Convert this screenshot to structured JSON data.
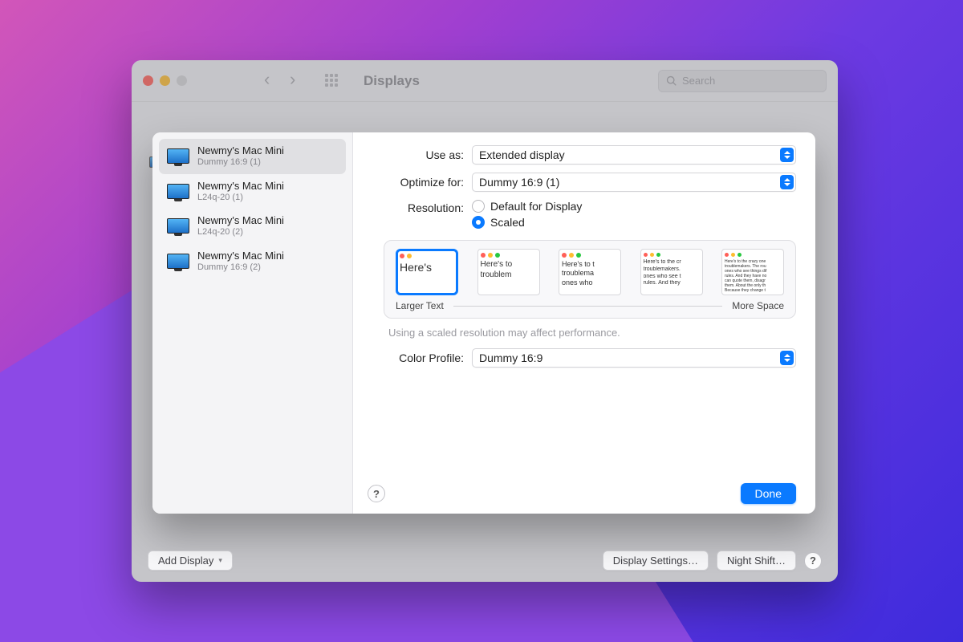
{
  "window": {
    "title": "Displays",
    "search_placeholder": "Search",
    "buttons": {
      "add_display": "Add Display",
      "display_settings": "Display Settings…",
      "night_shift": "Night Shift…"
    }
  },
  "sidebar": {
    "items": [
      {
        "title": "Newmy's Mac Mini",
        "subtitle": "Dummy 16:9 (1)",
        "selected": true
      },
      {
        "title": "Newmy's Mac Mini",
        "subtitle": "L24q-20 (1)",
        "selected": false
      },
      {
        "title": "Newmy's Mac Mini",
        "subtitle": "L24q-20 (2)",
        "selected": false
      },
      {
        "title": "Newmy's Mac Mini",
        "subtitle": "Dummy 16:9 (2)",
        "selected": false
      }
    ]
  },
  "form": {
    "use_as_label": "Use as:",
    "use_as_value": "Extended display",
    "optimize_label": "Optimize for:",
    "optimize_value": "Dummy 16:9 (1)",
    "resolution_label": "Resolution:",
    "resolution_options": {
      "default": "Default for Display",
      "scaled": "Scaled"
    },
    "resolution_selected": "scaled",
    "scale_labels": {
      "larger": "Larger Text",
      "more": "More Space"
    },
    "thumb_text": {
      "t1": "Here's",
      "t2a": "Here's to",
      "t2b": "troublem",
      "t3a": "Here's to t",
      "t3b": "troublema",
      "t3c": "ones who",
      "t4a": "Here's to the cr",
      "t4b": "troublemakers.",
      "t4c": "ones who see t",
      "t4d": "rules. And they",
      "t5a": "Here's to the crazy one",
      "t5b": "troublemakers. The rou",
      "t5c": "ones who see things dif",
      "t5d": "rules. And they have no",
      "t5e": "can quote them, disagr",
      "t5f": "them. About the only th",
      "t5g": "Because they change t"
    },
    "perf_note": "Using a scaled resolution may affect performance.",
    "color_profile_label": "Color Profile:",
    "color_profile_value": "Dummy 16:9"
  },
  "sheet": {
    "help": "?",
    "done": "Done"
  }
}
